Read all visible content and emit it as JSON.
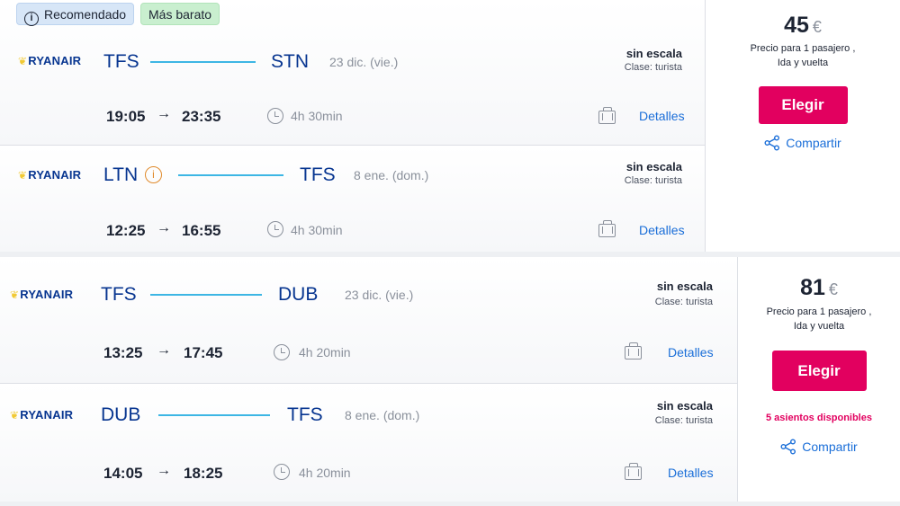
{
  "tags": {
    "recommended": "Recomendado",
    "cheapest": "Más barato"
  },
  "airline": "RYANAIR",
  "details_label": "Detalles",
  "choose_label": "Elegir",
  "share_label": "Compartir",
  "colors": {
    "accent": "#e2005f",
    "link": "#1a6ed8",
    "route_line": "#3db6e4",
    "brand_text": "#073590"
  },
  "offers": [
    {
      "price": "45",
      "currency": "€",
      "price_note_1": "Precio para 1 pasajero ,",
      "price_note_2": "Ida y vuelta",
      "flights": [
        {
          "from": "TFS",
          "to": "STN",
          "date": "23 dic. (vie.)",
          "stops": "sin escala",
          "class": "Clase: turista",
          "dep": "19:05",
          "arr": "23:35",
          "duration": "4h 30min"
        },
        {
          "from": "LTN",
          "to": "TFS",
          "date": "8 ene. (dom.)",
          "stops": "sin escala",
          "class": "Clase: turista",
          "dep": "12:25",
          "arr": "16:55",
          "duration": "4h 30min"
        }
      ]
    },
    {
      "price": "81",
      "currency": "€",
      "price_note_1": "Precio para 1 pasajero ,",
      "price_note_2": "Ida y vuelta",
      "seats": "5 asientos disponibles",
      "flights": [
        {
          "from": "TFS",
          "to": "DUB",
          "date": "23 dic. (vie.)",
          "stops": "sin escala",
          "class": "Clase: turista",
          "dep": "13:25",
          "arr": "17:45",
          "duration": "4h 20min"
        },
        {
          "from": "DUB",
          "to": "TFS",
          "date": "8 ene. (dom.)",
          "stops": "sin escala",
          "class": "Clase: turista",
          "dep": "14:05",
          "arr": "18:25",
          "duration": "4h 20min"
        }
      ]
    }
  ]
}
